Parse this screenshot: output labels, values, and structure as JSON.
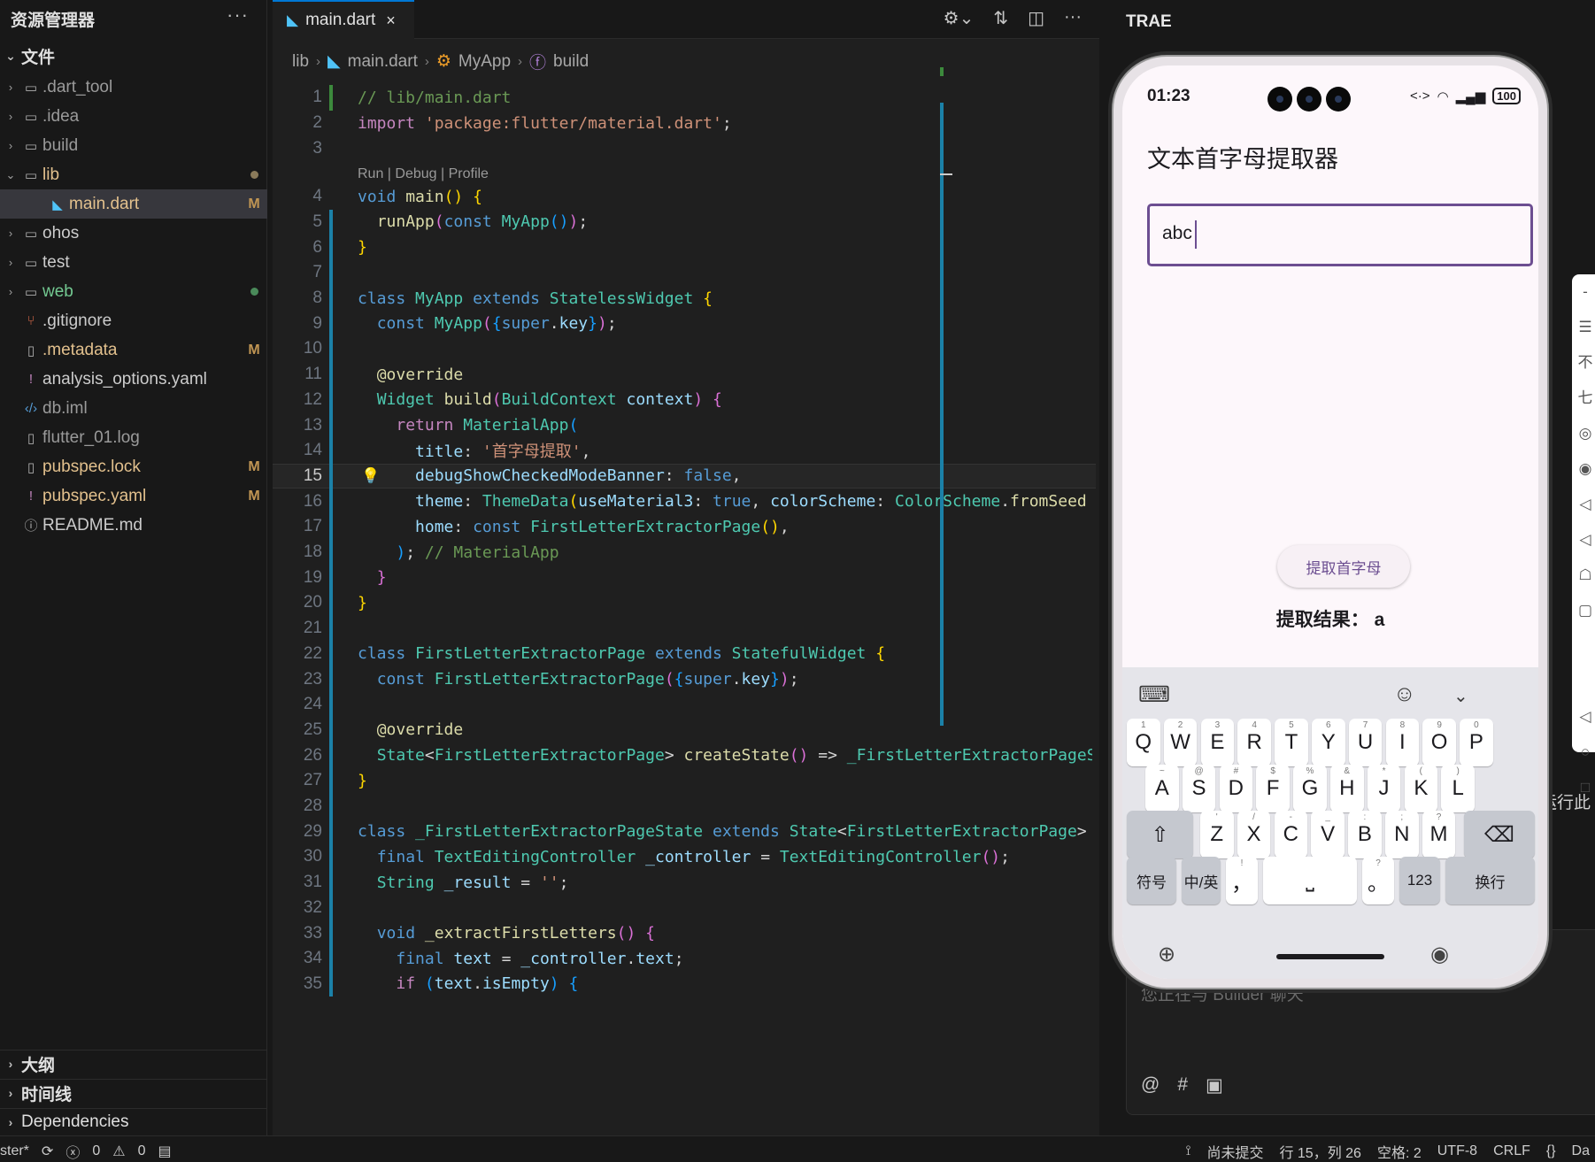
{
  "sidebar": {
    "title": "资源管理器",
    "more": "···",
    "files_section": "文件",
    "tree": [
      {
        "label": ".dart_tool",
        "kind": "folder",
        "state": "dim",
        "expanded": false
      },
      {
        "label": ".idea",
        "kind": "folder",
        "state": "dim",
        "expanded": false
      },
      {
        "label": "build",
        "kind": "folder",
        "state": "dim",
        "expanded": false
      },
      {
        "label": "lib",
        "kind": "folder",
        "state": "mod",
        "expanded": true,
        "dot_color": "#8a7a5a"
      },
      {
        "label": "main.dart",
        "kind": "dart",
        "state": "mod",
        "badge": "M",
        "selected": true
      },
      {
        "label": "ohos",
        "kind": "folder",
        "state": "norm",
        "expanded": false
      },
      {
        "label": "test",
        "kind": "folder",
        "state": "norm",
        "expanded": false
      },
      {
        "label": "web",
        "kind": "folder",
        "state": "green",
        "expanded": false,
        "dot_color": "#4a8a5a"
      },
      {
        "label": ".gitignore",
        "kind": "git",
        "state": "norm"
      },
      {
        "label": ".metadata",
        "kind": "file",
        "state": "mod",
        "badge": "M"
      },
      {
        "label": "analysis_options.yaml",
        "kind": "yaml",
        "state": "norm"
      },
      {
        "label": "db.iml",
        "kind": "xml",
        "state": "dim"
      },
      {
        "label": "flutter_01.log",
        "kind": "file",
        "state": "dim"
      },
      {
        "label": "pubspec.lock",
        "kind": "file",
        "state": "mod",
        "badge": "M"
      },
      {
        "label": "pubspec.yaml",
        "kind": "yaml",
        "state": "mod",
        "badge": "M"
      },
      {
        "label": "README.md",
        "kind": "info",
        "state": "norm"
      }
    ],
    "bottom_sections": [
      "大纲",
      "时间线",
      "Dependencies"
    ]
  },
  "editor": {
    "tab_label": "main.dart",
    "tab_close": "×",
    "breadcrumb": [
      "lib",
      "main.dart",
      "MyApp",
      "build"
    ],
    "codelens": "Run | Debug | Profile",
    "current_line": 15,
    "lines": [
      {
        "n": "1",
        "html": "<span class='cm'>// lib/main.dart</span>"
      },
      {
        "n": "2",
        "html": "<span class='kw'>import</span> <span class='st'>'package:flutter/material.dart'</span>;"
      },
      {
        "n": "3",
        "html": ""
      },
      {
        "n": "4",
        "html": "<span class='kw2'>void</span> <span class='fn'>main</span><span class='p1'>()</span> <span class='p1'>{</span>"
      },
      {
        "n": "5",
        "html": "  <span class='fn'>runApp</span><span class='p2'>(</span><span class='kw2'>const</span> <span class='ty'>MyApp</span><span class='p3'>()</span><span class='p2'>)</span>;"
      },
      {
        "n": "6",
        "html": "<span class='p1'>}</span>"
      },
      {
        "n": "7",
        "html": ""
      },
      {
        "n": "8",
        "html": "<span class='kw2'>class</span> <span class='ty'>MyApp</span> <span class='kw2'>extends</span> <span class='ty'>StatelessWidget</span> <span class='p1'>{</span>"
      },
      {
        "n": "9",
        "html": "  <span class='kw2'>const</span> <span class='ty'>MyApp</span><span class='p2'>(</span><span class='p3'>{</span><span class='kw2'>super</span>.<span class='pr'>key</span><span class='p3'>}</span><span class='p2'>)</span>;"
      },
      {
        "n": "10",
        "html": ""
      },
      {
        "n": "11",
        "html": "  <span class='an'>@override</span>"
      },
      {
        "n": "12",
        "html": "  <span class='ty'>Widget</span> <span class='fn'>build</span><span class='p2'>(</span><span class='ty'>BuildContext</span> <span class='pr'>context</span><span class='p2'>)</span> <span class='p2'>{</span>"
      },
      {
        "n": "13",
        "html": "    <span class='kw'>return</span> <span class='ty'>MaterialApp</span><span class='p3'>(</span>"
      },
      {
        "n": "14",
        "html": "      <span class='pr'>title</span>: <span class='st'>'首字母提取'</span>,"
      },
      {
        "n": "15",
        "html": "      <span class='pr'>debugShowCheckedModeBanner</span>: <span class='kw2'>false</span>,"
      },
      {
        "n": "16",
        "html": "      <span class='pr'>theme</span>: <span class='ty'>ThemeData</span><span class='p1'>(</span><span class='pr'>useMaterial3</span>: <span class='kw2'>true</span>, <span class='pr'>colorScheme</span>: <span class='ty'>ColorScheme</span>.<span class='fn'>fromSeed</span>"
      },
      {
        "n": "17",
        "html": "      <span class='pr'>home</span>: <span class='kw2'>const</span> <span class='ty'>FirstLetterExtractorPage</span><span class='p1'>()</span>,"
      },
      {
        "n": "18",
        "html": "    <span class='p3'>)</span>; <span class='cm'>// MaterialApp</span>"
      },
      {
        "n": "19",
        "html": "  <span class='p2'>}</span>"
      },
      {
        "n": "20",
        "html": "<span class='p1'>}</span>"
      },
      {
        "n": "21",
        "html": ""
      },
      {
        "n": "22",
        "html": "<span class='kw2'>class</span> <span class='ty'>FirstLetterExtractorPage</span> <span class='kw2'>extends</span> <span class='ty'>StatefulWidget</span> <span class='p1'>{</span>"
      },
      {
        "n": "23",
        "html": "  <span class='kw2'>const</span> <span class='ty'>FirstLetterExtractorPage</span><span class='p2'>(</span><span class='p3'>{</span><span class='kw2'>super</span>.<span class='pr'>key</span><span class='p3'>}</span><span class='p2'>)</span>;"
      },
      {
        "n": "24",
        "html": ""
      },
      {
        "n": "25",
        "html": "  <span class='an'>@override</span>"
      },
      {
        "n": "26",
        "html": "  <span class='ty'>State</span>&lt;<span class='ty'>FirstLetterExtractorPage</span>&gt; <span class='fn'>createState</span><span class='p2'>()</span> =&gt; <span class='ty'>_FirstLetterExtractorPageState</span>"
      },
      {
        "n": "27",
        "html": "<span class='p1'>}</span>"
      },
      {
        "n": "28",
        "html": ""
      },
      {
        "n": "29",
        "html": "<span class='kw2'>class</span> <span class='ty'>_FirstLetterExtractorPageState</span> <span class='kw2'>extends</span> <span class='ty'>State</span>&lt;<span class='ty'>FirstLetterExtractorPage</span>&gt;"
      },
      {
        "n": "30",
        "html": "  <span class='kw2'>final</span> <span class='ty'>TextEditingController</span> <span class='pr'>_controller</span> = <span class='ty'>TextEditingController</span><span class='p2'>()</span>;"
      },
      {
        "n": "31",
        "html": "  <span class='ty'>String</span> <span class='pr'>_result</span> = <span class='st'>''</span>;"
      },
      {
        "n": "32",
        "html": ""
      },
      {
        "n": "33",
        "html": "  <span class='kw2'>void</span> <span class='fn'>_extractFirstLetters</span><span class='p2'>()</span> <span class='p2'>{</span>"
      },
      {
        "n": "34",
        "html": "    <span class='kw2'>final</span> <span class='pr'>text</span> = <span class='pr'>_controller</span>.<span class='pr'>text</span>;"
      },
      {
        "n": "35",
        "html": "    <span class='kw'>if</span> <span class='p3'>(</span><span class='pr'>text</span>.<span class='pr'>isEmpty</span><span class='p3'>)</span> <span class='p3'>{</span>"
      }
    ]
  },
  "right_panel": {
    "brand": "TRAE",
    "chat_placeholder": "您正在与 Builder 聊天",
    "side_text": "运行此",
    "side_icons": [
      "-",
      "☰",
      "不",
      "七",
      "◎",
      "◉",
      "◁",
      "◁",
      "☖",
      "▢",
      "",
      "",
      "◁",
      "○",
      "□"
    ]
  },
  "phone": {
    "time": "01:23",
    "battery": "100",
    "app_title": "文本首字母提取器",
    "input_value": "abc",
    "button_label": "提取首字母",
    "result_label": "提取结果： a",
    "keyboard": {
      "row1": [
        [
          "Q",
          "1"
        ],
        [
          "W",
          "2"
        ],
        [
          "E",
          "3"
        ],
        [
          "R",
          "4"
        ],
        [
          "T",
          "5"
        ],
        [
          "Y",
          "6"
        ],
        [
          "U",
          "7"
        ],
        [
          "I",
          "8"
        ],
        [
          "O",
          "9"
        ],
        [
          "P",
          "0"
        ]
      ],
      "row2": [
        [
          "A",
          "~"
        ],
        [
          "S",
          "@"
        ],
        [
          "D",
          "#"
        ],
        [
          "F",
          "$"
        ],
        [
          "G",
          "%"
        ],
        [
          "H",
          "&"
        ],
        [
          "J",
          "*"
        ],
        [
          "K",
          "("
        ],
        [
          "L",
          ")"
        ]
      ],
      "row3": [
        [
          "Z",
          "'"
        ],
        [
          "X",
          "/"
        ],
        [
          "C",
          "-"
        ],
        [
          "V",
          "_"
        ],
        [
          "B",
          ":"
        ],
        [
          "N",
          ";"
        ],
        [
          "M",
          "?"
        ]
      ],
      "symbols": "符号",
      "lang": "中/英",
      "comma": "，",
      "comma_sub": "!",
      "period": "。",
      "period_sub": "?",
      "num": "123",
      "enter": "换行"
    }
  },
  "statusbar": {
    "branch": "ster*",
    "errors": "0",
    "warnings": "0",
    "commit": "尚未提交",
    "position": "行 15，列 26",
    "spaces": "空格: 2",
    "encoding": "UTF-8",
    "eol": "CRLF",
    "braces": "{}",
    "lang": "Da"
  }
}
